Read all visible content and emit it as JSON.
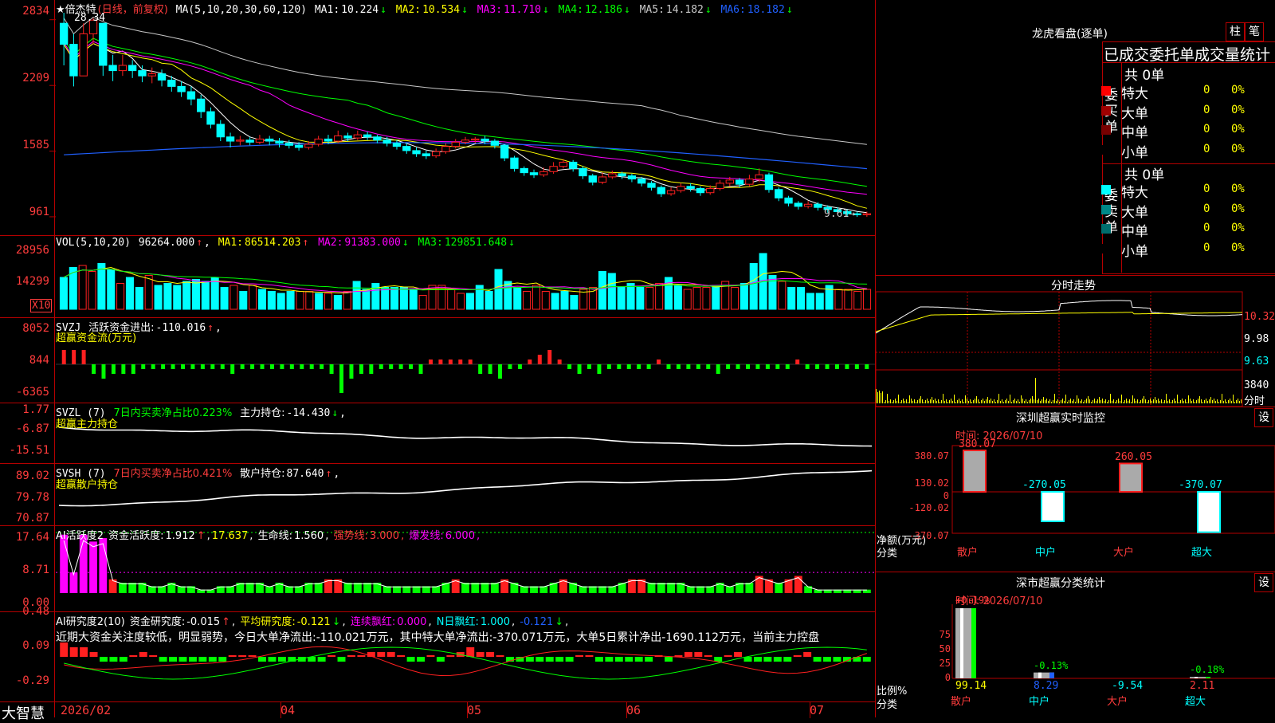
{
  "colors": {
    "up": "#ff2020",
    "down": "#00ffff",
    "grid": "#b40000",
    "ma1": "#ffffff",
    "ma2": "#ffff00",
    "ma3": "#ff00ff",
    "ma4": "#00ff00",
    "ma5": "#c8c8c8",
    "ma6": "#2060ff"
  },
  "kline": {
    "title": "★倍杰特",
    "period": "(日线，前复权)",
    "ma_label": "MA(5,10,20,30,60,120)",
    "ma": [
      {
        "name": "MA1:",
        "value": "10.224",
        "arrow": "↓",
        "color": "#ffffff"
      },
      {
        "name": "MA2:",
        "value": "10.534",
        "arrow": "↓",
        "color": "#ffff00"
      },
      {
        "name": "MA3:",
        "value": "11.710",
        "arrow": "↓",
        "color": "#ff00ff"
      },
      {
        "name": "MA4:",
        "value": "12.186",
        "arrow": "↓",
        "color": "#00ff00"
      },
      {
        "name": "MA5:",
        "value": "14.182",
        "arrow": "↓",
        "color": "#c8c8c8"
      },
      {
        "name": "MA6:",
        "value": "18.182",
        "arrow": "↓",
        "color": "#2060ff"
      }
    ],
    "y_ticks": [
      "2834",
      "2209",
      "1585",
      "961"
    ],
    "high_label": "28.34",
    "low_label": "9.61→",
    "bars": [
      [
        28,
        26,
        29,
        24
      ],
      [
        26,
        23,
        27,
        22
      ],
      [
        23,
        27,
        28,
        23
      ],
      [
        27,
        28.3,
        28.5,
        26
      ],
      [
        28,
        24,
        28,
        23
      ],
      [
        24,
        23.5,
        25,
        22.5
      ],
      [
        23.5,
        24,
        25,
        23
      ],
      [
        24,
        23.5,
        24.5,
        22.8
      ],
      [
        23.5,
        23,
        24,
        22.4
      ],
      [
        23,
        23.2,
        23.8,
        22.3
      ],
      [
        23.2,
        22.6,
        23.6,
        22
      ],
      [
        22.6,
        22,
        23,
        21.5
      ],
      [
        22,
        21.5,
        22.5,
        21
      ],
      [
        21.5,
        20.8,
        22,
        20.2
      ],
      [
        20.8,
        19.6,
        21.2,
        19
      ],
      [
        19.6,
        18.4,
        20,
        18
      ],
      [
        18.4,
        17.2,
        18.8,
        16.8
      ],
      [
        17.2,
        16.8,
        17.6,
        16.2
      ],
      [
        16.8,
        16.9,
        17.3,
        16.4
      ],
      [
        16.9,
        16.7,
        17.2,
        16.4
      ],
      [
        16.7,
        17,
        17.4,
        16.5
      ],
      [
        17,
        16.8,
        17.3,
        16.4
      ],
      [
        16.8,
        16.6,
        17.1,
        16.2
      ],
      [
        16.6,
        16.4,
        16.9,
        16.1
      ],
      [
        16.4,
        16.2,
        16.7,
        15.9
      ],
      [
        16.2,
        16.5,
        16.8,
        16
      ],
      [
        16.5,
        17,
        17.3,
        16.3
      ],
      [
        17,
        16.8,
        17.4,
        16.5
      ],
      [
        16.8,
        17.3,
        17.8,
        16.6
      ],
      [
        17.3,
        17.1,
        17.6,
        16.8
      ],
      [
        17.1,
        17.4,
        17.8,
        16.9
      ],
      [
        17.4,
        17.2,
        17.7,
        16.9
      ],
      [
        17.2,
        16.9,
        17.4,
        16.6
      ],
      [
        16.9,
        16.6,
        17.2,
        16.3
      ],
      [
        16.6,
        16.3,
        16.9,
        16
      ],
      [
        16.3,
        15.9,
        16.6,
        15.6
      ],
      [
        15.9,
        15.6,
        16.2,
        15.3
      ],
      [
        15.6,
        15.4,
        15.9,
        15.1
      ],
      [
        15.4,
        15.8,
        16.1,
        15.2
      ],
      [
        15.8,
        16.3,
        16.6,
        15.6
      ],
      [
        16.3,
        16.7,
        17,
        16.1
      ],
      [
        16.7,
        16.9,
        17.2,
        16.5
      ],
      [
        16.9,
        17,
        17.2,
        16.6
      ],
      [
        17,
        16.8,
        17.3,
        16.5
      ],
      [
        16.8,
        16.4,
        17,
        16.1
      ],
      [
        16.4,
        15.2,
        16.5,
        14.9
      ],
      [
        15.2,
        14.2,
        15.4,
        13.9
      ],
      [
        14.2,
        13.8,
        14.4,
        13.5
      ],
      [
        13.8,
        13.6,
        14.1,
        13.3
      ],
      [
        13.6,
        13.9,
        14.3,
        13.4
      ],
      [
        13.9,
        14.4,
        14.8,
        13.7
      ],
      [
        14.4,
        14.8,
        15.1,
        14.2
      ],
      [
        14.8,
        14.2,
        15,
        13.9
      ],
      [
        14.2,
        13.5,
        14.4,
        13.2
      ],
      [
        13.5,
        12.9,
        13.7,
        12.6
      ],
      [
        12.9,
        13.4,
        13.8,
        12.7
      ],
      [
        13.4,
        13.7,
        14,
        13.2
      ],
      [
        13.7,
        13.5,
        13.9,
        13.2
      ],
      [
        13.5,
        13.2,
        13.7,
        12.9
      ],
      [
        13.2,
        12.8,
        13.4,
        12.5
      ],
      [
        12.8,
        12.4,
        13,
        12.1
      ],
      [
        12.4,
        11.8,
        12.6,
        11.5
      ],
      [
        11.8,
        12.1,
        12.4,
        11.6
      ],
      [
        12.1,
        12.5,
        12.8,
        11.9
      ],
      [
        12.5,
        12.3,
        12.8,
        12
      ],
      [
        12.3,
        11.9,
        12.5,
        11.6
      ],
      [
        11.9,
        12.3,
        12.6,
        11.7
      ],
      [
        12.3,
        12.8,
        13.1,
        12.1
      ],
      [
        12.8,
        13.1,
        13.4,
        12.5
      ],
      [
        13.1,
        12.7,
        13.3,
        12.4
      ],
      [
        12.7,
        13.2,
        13.6,
        12.5
      ],
      [
        13.2,
        13.6,
        14.2,
        12.9
      ],
      [
        13.6,
        12.2,
        13.8,
        11.9
      ],
      [
        12.2,
        11.4,
        12.4,
        11.1
      ],
      [
        11.4,
        10.9,
        11.6,
        10.6
      ],
      [
        10.9,
        10.6,
        11.1,
        10.3
      ],
      [
        10.6,
        10.8,
        11.1,
        10.4
      ],
      [
        10.8,
        10.5,
        11,
        10.2
      ],
      [
        10.5,
        10.3,
        10.7,
        10
      ],
      [
        10.3,
        10.1,
        10.5,
        9.9
      ],
      [
        10.1,
        9.9,
        10.3,
        9.7
      ],
      [
        9.9,
        9.8,
        10.1,
        9.6
      ],
      [
        9.8,
        9.9,
        10.1,
        9.61
      ]
    ]
  },
  "vol": {
    "label": "VOL(5,10,20)",
    "value": "96264.000",
    "value_arrow": "↑",
    "ma": [
      {
        "name": "MA1:",
        "value": "86514.203",
        "arrow": "↑",
        "color": "#ffff00"
      },
      {
        "name": "MA2:",
        "value": "91383.000",
        "arrow": "↓",
        "color": "#ff00ff"
      },
      {
        "name": "MA3:",
        "value": "129851.648",
        "arrow": "↓",
        "color": "#00ff00"
      }
    ],
    "y_ticks": [
      "28956",
      "14299"
    ],
    "unit": "X10",
    "values": [
      16,
      21,
      22,
      19,
      23,
      20,
      13,
      16,
      11,
      17,
      12,
      13,
      12,
      14,
      15,
      14,
      16,
      11,
      12,
      9,
      12,
      10,
      9,
      8,
      9,
      9,
      9,
      8,
      8,
      7,
      9,
      14,
      10,
      13,
      11,
      11,
      11,
      10,
      7,
      12,
      12,
      10,
      8,
      8,
      12,
      9,
      20,
      14,
      11,
      9,
      12,
      9,
      8,
      9,
      7,
      10,
      11,
      19,
      18,
      11,
      13,
      11,
      11,
      13,
      16,
      12,
      10,
      11,
      11,
      12,
      14,
      11,
      13,
      23,
      28,
      17,
      14,
      11,
      11,
      8,
      8,
      12,
      10,
      10,
      9,
      10
    ]
  },
  "svzj": {
    "label": "SVZJ",
    "title": "活跃资金进出:",
    "value": "-110.016",
    "arrow": "↑",
    "sub": "超赢资金流(万元)",
    "y_ticks": [
      "8052",
      "844",
      "-6365"
    ],
    "values": [
      3,
      3,
      3,
      -2,
      -3,
      -2,
      -2,
      -2,
      -1,
      -1,
      -1,
      -1,
      -1,
      -1,
      -1,
      -1,
      -1,
      -2,
      -1,
      -1,
      -1,
      -1,
      -1,
      -1,
      -1,
      -1,
      -1,
      -2,
      -6,
      -3,
      -2,
      -2,
      -1,
      -1,
      -1,
      -1,
      -2,
      1,
      1,
      1,
      1,
      1,
      -2,
      -2,
      -3,
      -1,
      -1,
      1,
      2,
      3,
      1,
      -1,
      -2,
      -1,
      -2,
      -1,
      -1,
      -1,
      -1,
      -1,
      1,
      -1,
      -1,
      -1,
      -1,
      -1,
      -2,
      -1,
      -1,
      -1,
      -1,
      -1,
      -1,
      -1,
      1,
      -1,
      -1,
      -1,
      -1,
      -1,
      -1,
      -1
    ]
  },
  "svzl": {
    "label": "SVZL (7)",
    "note": "7日内买卖净占比0.223%",
    "title": "主力持仓:",
    "value": "-14.430",
    "arrow": "↓",
    "sub": "超赢主力持仓",
    "y_ticks": [
      "1.77",
      "-6.87",
      "-15.51"
    ]
  },
  "svsh": {
    "label": "SVSH (7)",
    "note": "7日内买卖净占比0.421%",
    "title": "散户持仓:",
    "value": "87.640",
    "arrow": "↑",
    "sub": "超赢散户持仓",
    "y_ticks": [
      "89.02",
      "79.78",
      "70.87"
    ]
  },
  "ai1": {
    "label": "AI活跃度2",
    "title": "资金活跃度:",
    "value": "1.912",
    "arrow": "↑",
    "v2": "17.637",
    "life": "生命线:",
    "life_value": "1.560",
    "strong": "强势线:",
    "strong_value": "3.000",
    "burst": "爆发线:",
    "burst_value": "6.000",
    "y_ticks": [
      "17.64",
      "8.71",
      "0.00"
    ],
    "values": [
      17,
      6,
      17,
      15,
      16,
      4,
      3,
      3,
      3,
      2,
      2,
      3,
      2,
      2,
      1,
      1,
      2,
      2,
      3,
      3,
      3,
      2,
      3,
      2,
      2,
      3,
      3,
      4,
      4,
      3,
      3,
      3,
      3,
      2,
      2,
      2,
      2,
      2,
      2,
      3,
      4,
      3,
      3,
      3,
      3,
      4,
      3,
      2,
      2,
      2,
      3,
      4,
      3,
      2,
      2,
      2,
      2,
      3,
      4,
      4,
      3,
      3,
      3,
      3,
      2,
      2,
      2,
      3,
      2,
      3,
      3,
      5,
      4,
      3,
      4,
      5,
      2,
      1,
      1,
      1,
      1,
      1,
      1
    ]
  },
  "ai2": {
    "label": "AI研究度2(10)",
    "title": "资金研究度:",
    "value": "-0.015",
    "arrow": "↑",
    "avg": "平均研究度:",
    "avg_value": "-0.121",
    "avg_arrow": "↓",
    "red": "连续飘红:",
    "red_value": "0.000",
    "nred": "N日飘红:",
    "nred_value": "1.000",
    "last": "-0.121",
    "last_arrow": "↓",
    "summary": "近期大资金关注度较低，明显弱势，今日大单净流出:-110.021万元，其中特大单净流出:-370.071万元，大单5日累计净出-1690.112万元，当前主力控盘",
    "y_ticks": [
      "0.48",
      "0.09",
      "-0.29"
    ],
    "values": [
      3,
      2,
      2,
      1,
      -1,
      -1,
      -1,
      0,
      1,
      0,
      -1,
      -1,
      -1,
      -1,
      -1,
      -1,
      -1,
      0,
      0,
      0,
      -1,
      -1,
      -1,
      -1,
      -1,
      -1,
      -1,
      0,
      -1,
      0,
      0,
      1,
      1,
      1,
      0,
      -1,
      -1,
      0,
      -1,
      0,
      1,
      2,
      1,
      1,
      0,
      -1,
      -1,
      -1,
      -1,
      -1,
      -1,
      -1,
      0,
      0,
      -1,
      -1,
      -1,
      -1,
      -1,
      -1,
      0,
      -1,
      0,
      1,
      1,
      0,
      -1,
      0,
      1,
      -1,
      -1,
      -1,
      -1,
      -1,
      0,
      1,
      -1,
      -1,
      -1,
      -1,
      -1,
      -1
    ]
  },
  "x_axis": [
    "2026/02",
    "04",
    "05",
    "06",
    "07"
  ],
  "brand": "大智慧",
  "dragon": {
    "title": "龙虎看盘(逐单)",
    "btn1": "柱",
    "btn2": "笔",
    "header": "已成交委托单成交量统计",
    "buy": {
      "side": "委买单",
      "total": "共 0单",
      "rows": [
        {
          "name": "特大",
          "count": "0",
          "pct": "0%",
          "color": "#ff0000"
        },
        {
          "name": "大单",
          "count": "0",
          "pct": "0%",
          "color": "#a00000"
        },
        {
          "name": "中单",
          "count": "0",
          "pct": "0%",
          "color": "#780000"
        },
        {
          "name": "小单",
          "count": "0",
          "pct": "0%",
          "color": "#000000"
        }
      ]
    },
    "sell": {
      "side": "委卖单",
      "total": "共 0单",
      "rows": [
        {
          "name": "特大",
          "count": "0",
          "pct": "0%",
          "color": "#00ffff"
        },
        {
          "name": "大单",
          "count": "0",
          "pct": "0%",
          "color": "#008888"
        },
        {
          "name": "中单",
          "count": "0",
          "pct": "0%",
          "color": "#006e6e"
        },
        {
          "name": "小单",
          "count": "0",
          "pct": "0%",
          "color": "#000000"
        }
      ]
    }
  },
  "intraday": {
    "title": "分时走势",
    "price1": "10.32",
    "price2": "9.98",
    "price3": "9.63",
    "vol": "3840",
    "vol_label": "分时"
  },
  "monitor": {
    "title": "深圳超赢实时监控",
    "btn": "设",
    "time": "时间: 2026/07/10",
    "y_ticks": [
      "380.07",
      "130.02",
      "0",
      "-120.02",
      "-370.07"
    ],
    "y_label": "净额(万元)",
    "x_label": "分类",
    "bars": [
      {
        "cat": "散户",
        "value": 380.07,
        "label": "380.07"
      },
      {
        "cat": "中户",
        "value": -270.05,
        "label": "-270.05"
      },
      {
        "cat": "大户",
        "value": 260.05,
        "label": "260.05"
      },
      {
        "cat": "超大",
        "value": -370.07,
        "label": "-370.07"
      }
    ]
  },
  "classify": {
    "title": "深市超赢分类统计",
    "btn": "设",
    "time": "时间: 2026/07/10",
    "y_ticks": [
      "75",
      "50",
      "25",
      "0"
    ],
    "y_label": "比例%",
    "x_label": "分类",
    "bars": [
      {
        "cat": "散户",
        "top": "+0.19%",
        "bottom": "99.14",
        "value": 99.14
      },
      {
        "cat": "中户",
        "top": "-0.13%",
        "bottom": "8.29",
        "value": 8.29
      },
      {
        "cat": "大户",
        "top": "",
        "bottom": "-9.54",
        "value": 0
      },
      {
        "cat": "超大",
        "top": "-0.18%",
        "bottom": "2.11",
        "value": 2.11
      }
    ]
  }
}
